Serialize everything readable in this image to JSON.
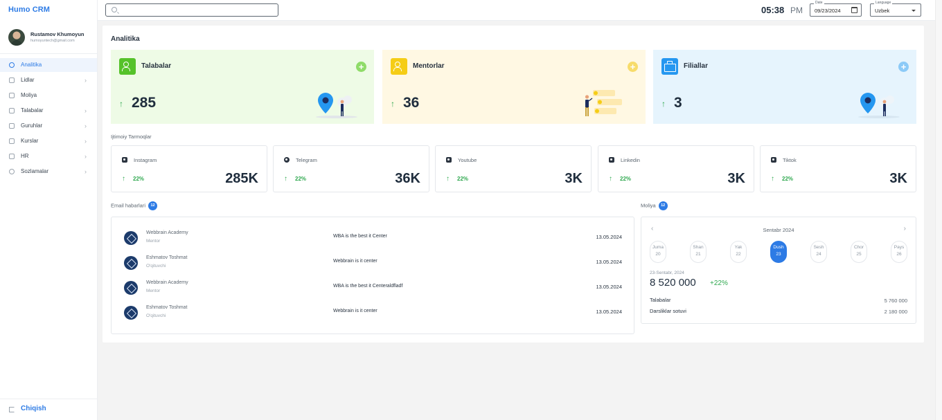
{
  "app": {
    "logo": "Humo CRM"
  },
  "user": {
    "name": "Rustamov Khumoyun",
    "email": "humoyuntech@gmail.com"
  },
  "sidebar": {
    "items": [
      {
        "label": "Analitika",
        "icon": "analytics-icon",
        "active": true,
        "chevron": ""
      },
      {
        "label": "Lidlar",
        "icon": "leads-icon",
        "chevron": "›"
      },
      {
        "label": "Moliya",
        "icon": "finance-icon",
        "chevron": ""
      },
      {
        "label": "Talabalar",
        "icon": "graduation-cap-icon",
        "chevron": "›"
      },
      {
        "label": "Guruhlar",
        "icon": "groups-icon",
        "chevron": "›"
      },
      {
        "label": "Kurslar",
        "icon": "courses-icon",
        "chevron": "›"
      },
      {
        "label": "HR",
        "icon": "hr-icon",
        "chevron": "›"
      },
      {
        "label": "Sozlamalar",
        "icon": "settings-icon",
        "chevron": "›"
      }
    ],
    "logout": "Chiqish"
  },
  "topbar": {
    "search_placeholder": "",
    "time": "05:38",
    "ampm": "PM",
    "date_label": "Date",
    "date_value": "09/23/2024",
    "language_label": "Language",
    "language_value": "Uzbek"
  },
  "analytics": {
    "title": "Analitika",
    "cards": [
      {
        "title": "Talabalar",
        "value": "285",
        "bg": "#eefbe6",
        "icon_bg": "#55c22a",
        "plus_color": "#8fdc69"
      },
      {
        "title": "Mentorlar",
        "value": "36",
        "bg": "#fff8e3",
        "icon_bg": "#f5cd16",
        "plus_color": "#f7dc6b"
      },
      {
        "title": "Filiallar",
        "value": "3",
        "bg": "#e6f4fd",
        "icon_bg": "#2597f0",
        "plus_color": "#8ccaf7"
      }
    ]
  },
  "social": {
    "title": "Ijtimoiy Tarmoqlar",
    "cards": [
      {
        "name": "Instagram",
        "pct": "22%",
        "value": "285K",
        "icon": "instagram-icon"
      },
      {
        "name": "Telegram",
        "pct": "22%",
        "value": "36K",
        "icon": "telegram-icon"
      },
      {
        "name": "Youtube",
        "pct": "22%",
        "value": "3K",
        "icon": "youtube-icon"
      },
      {
        "name": "Linkedin",
        "pct": "22%",
        "value": "3K",
        "icon": "linkedin-icon"
      },
      {
        "name": "Tiktok",
        "pct": "22%",
        "value": "3K",
        "icon": "tiktok-icon"
      }
    ]
  },
  "emails": {
    "title": "Email habarlari",
    "count": "12",
    "rows": [
      {
        "sender": "Webbrain Academy",
        "role": "Mentor",
        "subject": "WBA is the best it Center",
        "date": "13.05.2024"
      },
      {
        "sender": "Eshmatov Toshmat",
        "role": "O'qituvchi",
        "subject": "Webbrain is it center",
        "date": "13.05.2024"
      },
      {
        "sender": "Webbrain Academy",
        "role": "Mentor",
        "subject": "WBA is the best it Centeraldfladf",
        "date": "13.05.2024"
      },
      {
        "sender": "Eshmatov Toshmat",
        "role": "O'qituvchi",
        "subject": "Webbrain is it center",
        "date": "13.05.2024"
      }
    ]
  },
  "finance": {
    "title": "Moliya",
    "count": "12",
    "month": "Sentabr 2024",
    "days": [
      {
        "name": "Juma",
        "num": "20"
      },
      {
        "name": "Shan",
        "num": "21"
      },
      {
        "name": "Yak",
        "num": "22"
      },
      {
        "name": "Dush",
        "num": "23",
        "active": true
      },
      {
        "name": "Sesh",
        "num": "24"
      },
      {
        "name": "Chor",
        "num": "25"
      },
      {
        "name": "Pays",
        "num": "26"
      }
    ],
    "selected_date": "23-Sentabr, 2024",
    "amount": "8 520 000",
    "change": "+22%",
    "rows": [
      {
        "label": "Talabalar",
        "value": "5 760 000"
      },
      {
        "label": "Darsliklar sotuvi",
        "value": "2 180 000"
      }
    ]
  }
}
